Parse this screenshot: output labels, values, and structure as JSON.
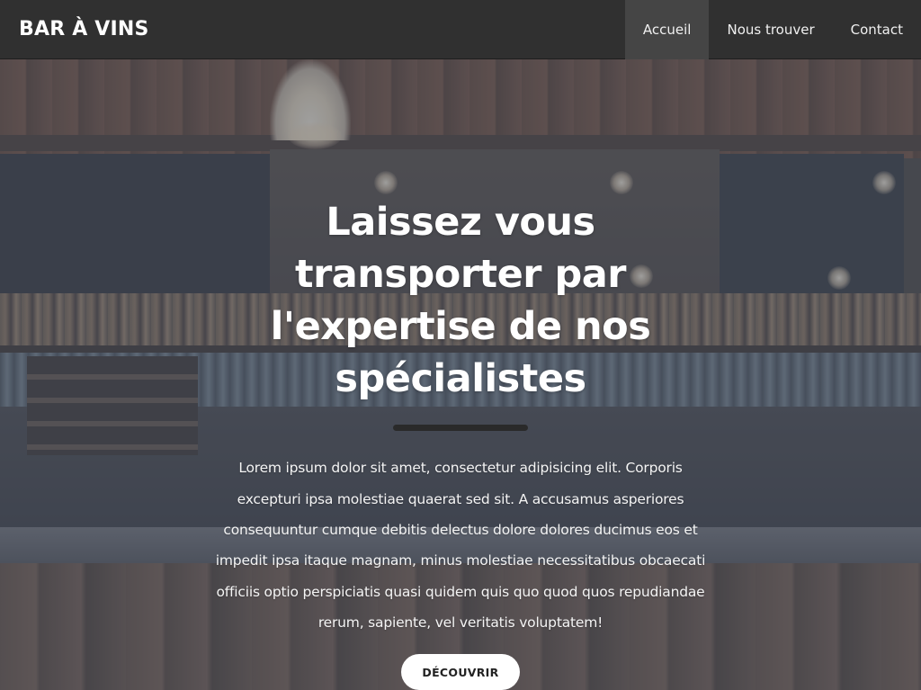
{
  "navbar": {
    "brand": "BAR À VINS",
    "links": [
      {
        "label": "Accueil",
        "active": true
      },
      {
        "label": "Nous trouver",
        "active": false
      },
      {
        "label": "Contact",
        "active": false
      }
    ]
  },
  "hero": {
    "title": "Laissez vous transporter par l'expertise de nos spécialistes",
    "text": "Lorem ipsum dolor sit amet, consectetur adipisicing elit. Corporis excepturi ipsa molestiae quaerat sed sit. A accusamus asperiores consequuntur cumque debitis delectus dolore dolores ducimus eos et impedit ipsa itaque magnam, minus molestiae necessitatibus obcaecati officiis optio perspiciatis quasi quidem quis quo quod quos repudiandae rerum, sapiente, vel veritatis voluptatem!",
    "cta_label": "DÉCOUVRIR"
  },
  "colors": {
    "navbar_bg": "#303030",
    "nav_active_bg": "#454545",
    "divider": "#2a2a2a",
    "cta_bg": "#ffffff"
  }
}
